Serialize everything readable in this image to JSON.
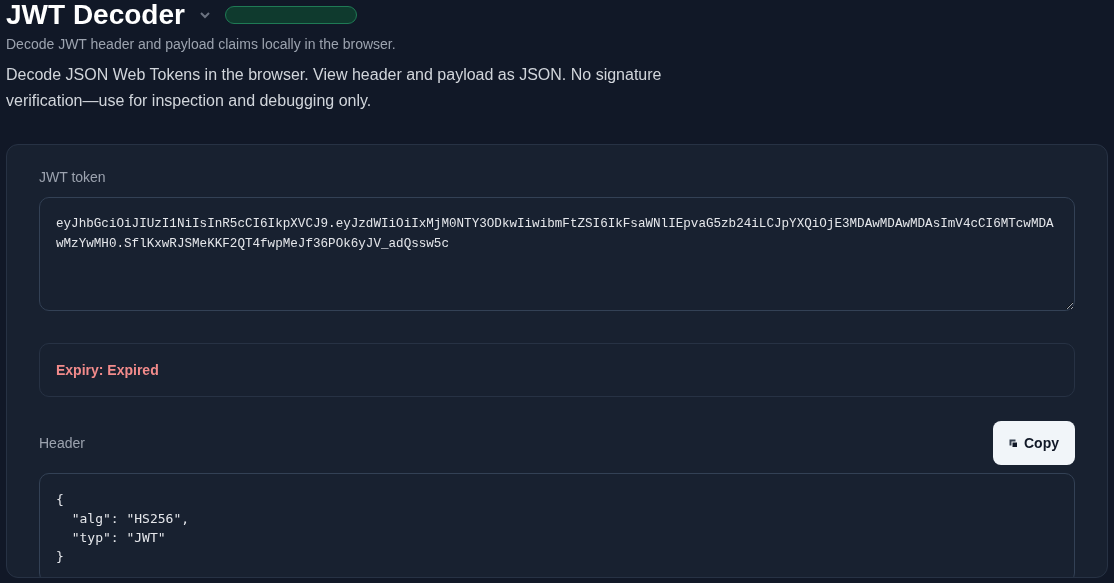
{
  "page": {
    "title": "JWT Decoder",
    "subtitle": "Decode JWT header and payload claims locally in the browser.",
    "description": "Decode JSON Web Tokens in the browser. View header and payload as JSON. No signature verification—use for inspection and debugging only."
  },
  "token_field": {
    "label": "JWT token",
    "value": "eyJhbGciOiJIUzI1NiIsInR5cCI6IkpXVCJ9.eyJzdWIiOiIxMjM0NTY3ODkwIiwibmFtZSI6IkFsaWNlIEpvaG5zb24iLCJpYXQiOjE3MDAwMDAwMDAsImV4cCI6MTcwMDAwMzYwMH0.SflKxwRJSMeKKF2QT4fwpMeJf36POk6yJV_adQssw5c"
  },
  "expiry": {
    "text": "Expiry: Expired",
    "expired": true
  },
  "header_section": {
    "label": "Header",
    "copy_button": "Copy",
    "json": "{\n  \"alg\": \"HS256\",\n  \"typ\": \"JWT\"\n}"
  }
}
